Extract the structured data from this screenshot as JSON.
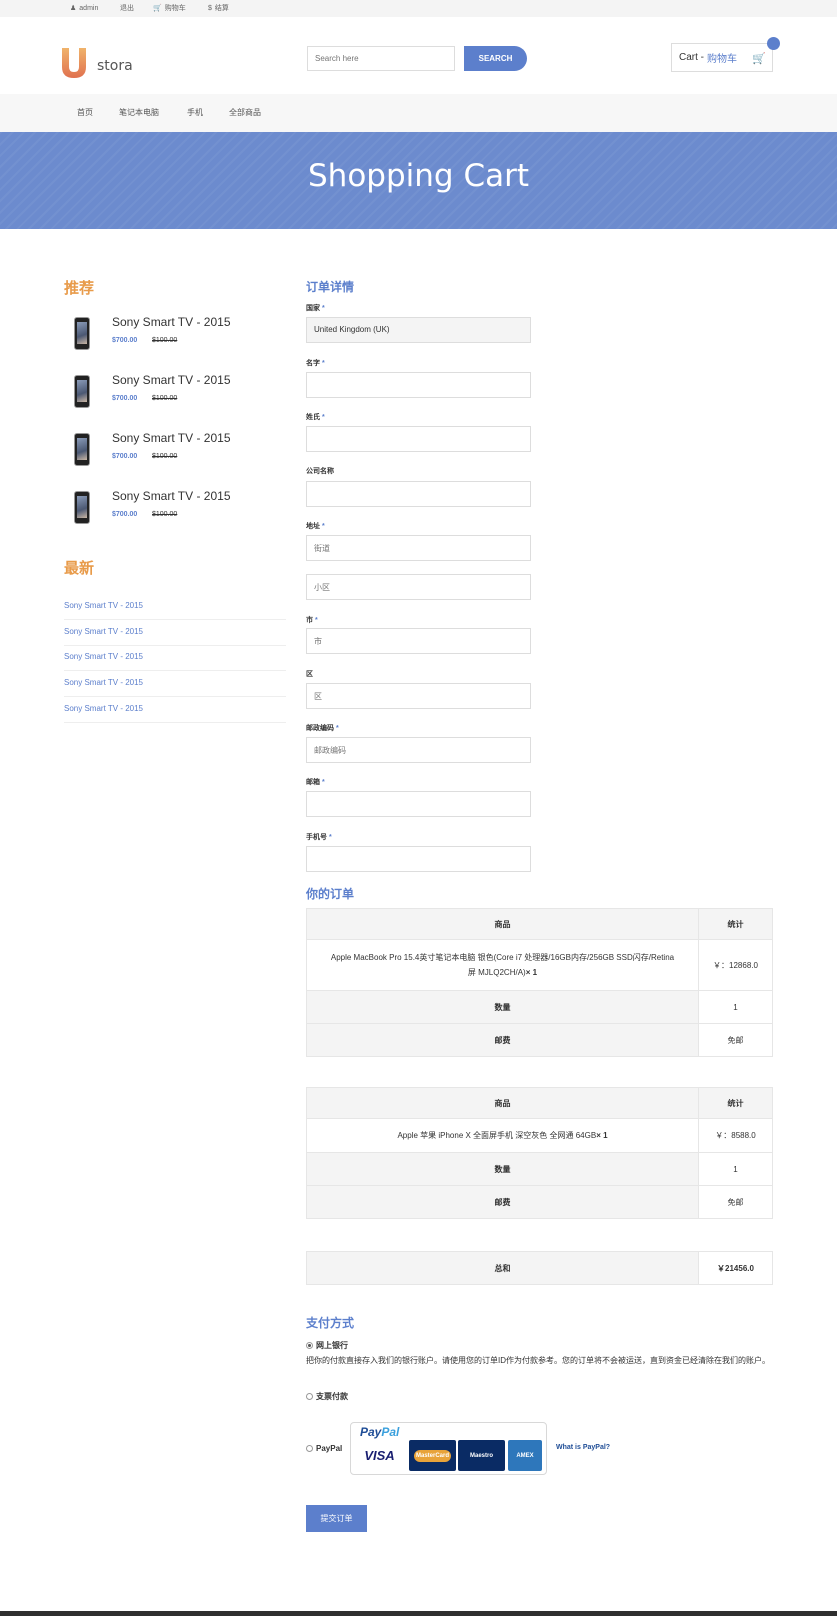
{
  "topbar": {
    "items": [
      {
        "icon": "user-icon",
        "label": "admin"
      },
      {
        "icon": "",
        "label": "退出"
      },
      {
        "icon": "cart-icon",
        "label": "购物车"
      },
      {
        "icon": "dollar-icon",
        "label": "结算"
      }
    ]
  },
  "header": {
    "logo_letter": "U",
    "logo_text": "stora",
    "search_placeholder": "Search here",
    "search_button": "SEARCH",
    "cart_label": "Cart -",
    "cart_label_cn": "购物车"
  },
  "nav": {
    "items": [
      "首页",
      "笔记本电脑",
      "手机",
      "全部商品"
    ]
  },
  "banner": {
    "title": "Shopping Cart"
  },
  "sidebar": {
    "recommend_title": "推荐",
    "products": [
      {
        "name": "Sony Smart TV - 2015",
        "price": "$700.00",
        "old_price": "$100.00"
      },
      {
        "name": "Sony Smart TV - 2015",
        "price": "$700.00",
        "old_price": "$100.00"
      },
      {
        "name": "Sony Smart TV - 2015",
        "price": "$700.00",
        "old_price": "$100.00"
      },
      {
        "name": "Sony Smart TV - 2015",
        "price": "$700.00",
        "old_price": "$100.00"
      }
    ],
    "latest_title": "最新",
    "latest": [
      "Sony Smart TV - 2015",
      "Sony Smart TV - 2015",
      "Sony Smart TV - 2015",
      "Sony Smart TV - 2015",
      "Sony Smart TV - 2015"
    ]
  },
  "form": {
    "title": "订单详情",
    "country_label": "国家",
    "country_value": "United Kingdom (UK)",
    "first_name_label": "名字",
    "last_name_label": "姓氏",
    "company_label": "公司名称",
    "address_label": "地址",
    "street_placeholder": "街道",
    "district_placeholder": "小区",
    "city_label": "市",
    "city_placeholder": "市",
    "area_label": "区",
    "area_placeholder": "区",
    "zip_label": "邮政编码",
    "zip_placeholder": "邮政编码",
    "email_label": "邮箱",
    "phone_label": "手机号",
    "required_mark": "*"
  },
  "order": {
    "title": "你的订单",
    "col_product": "商品",
    "col_total": "统计",
    "row_qty": "数量",
    "row_shipping": "邮费",
    "items": [
      {
        "name": "Apple MacBook Pro 15.4英寸笔记本电脑 银色(Core i7 处理器/16GB内存/256GB SSD闪存/Retina屏 MJLQ2CH/A)",
        "qty_suffix": "× 1",
        "total": "￥：12868.0",
        "qty": "1",
        "shipping": "免邮"
      },
      {
        "name": "Apple 苹果 iPhone X 全面屏手机 深空灰色 全网通 64GB",
        "qty_suffix": "× 1",
        "total": "￥：8588.0",
        "qty": "1",
        "shipping": "免邮"
      }
    ],
    "sum_label": "总和",
    "sum_value": "￥21456.0"
  },
  "payment": {
    "title": "支付方式",
    "bank_label": "网上银行",
    "bank_desc": "把你的付款直接存入我们的银行账户。请使用您的订单ID作为付款参考。您的订单将不会被运送，直到资金已经清除在我们的账户。",
    "cheque_label": "支票付款",
    "paypal_label": "PayPal",
    "paypal_logo_a": "Pay",
    "paypal_logo_b": "Pal",
    "cards": [
      "VISA",
      "MasterCard",
      "Maestro",
      "AMEX"
    ],
    "what_link": "What is PayPal?",
    "submit": "提交订单"
  },
  "colors": {
    "accent": "#5c7fcc",
    "orange": "#e89b4a"
  }
}
